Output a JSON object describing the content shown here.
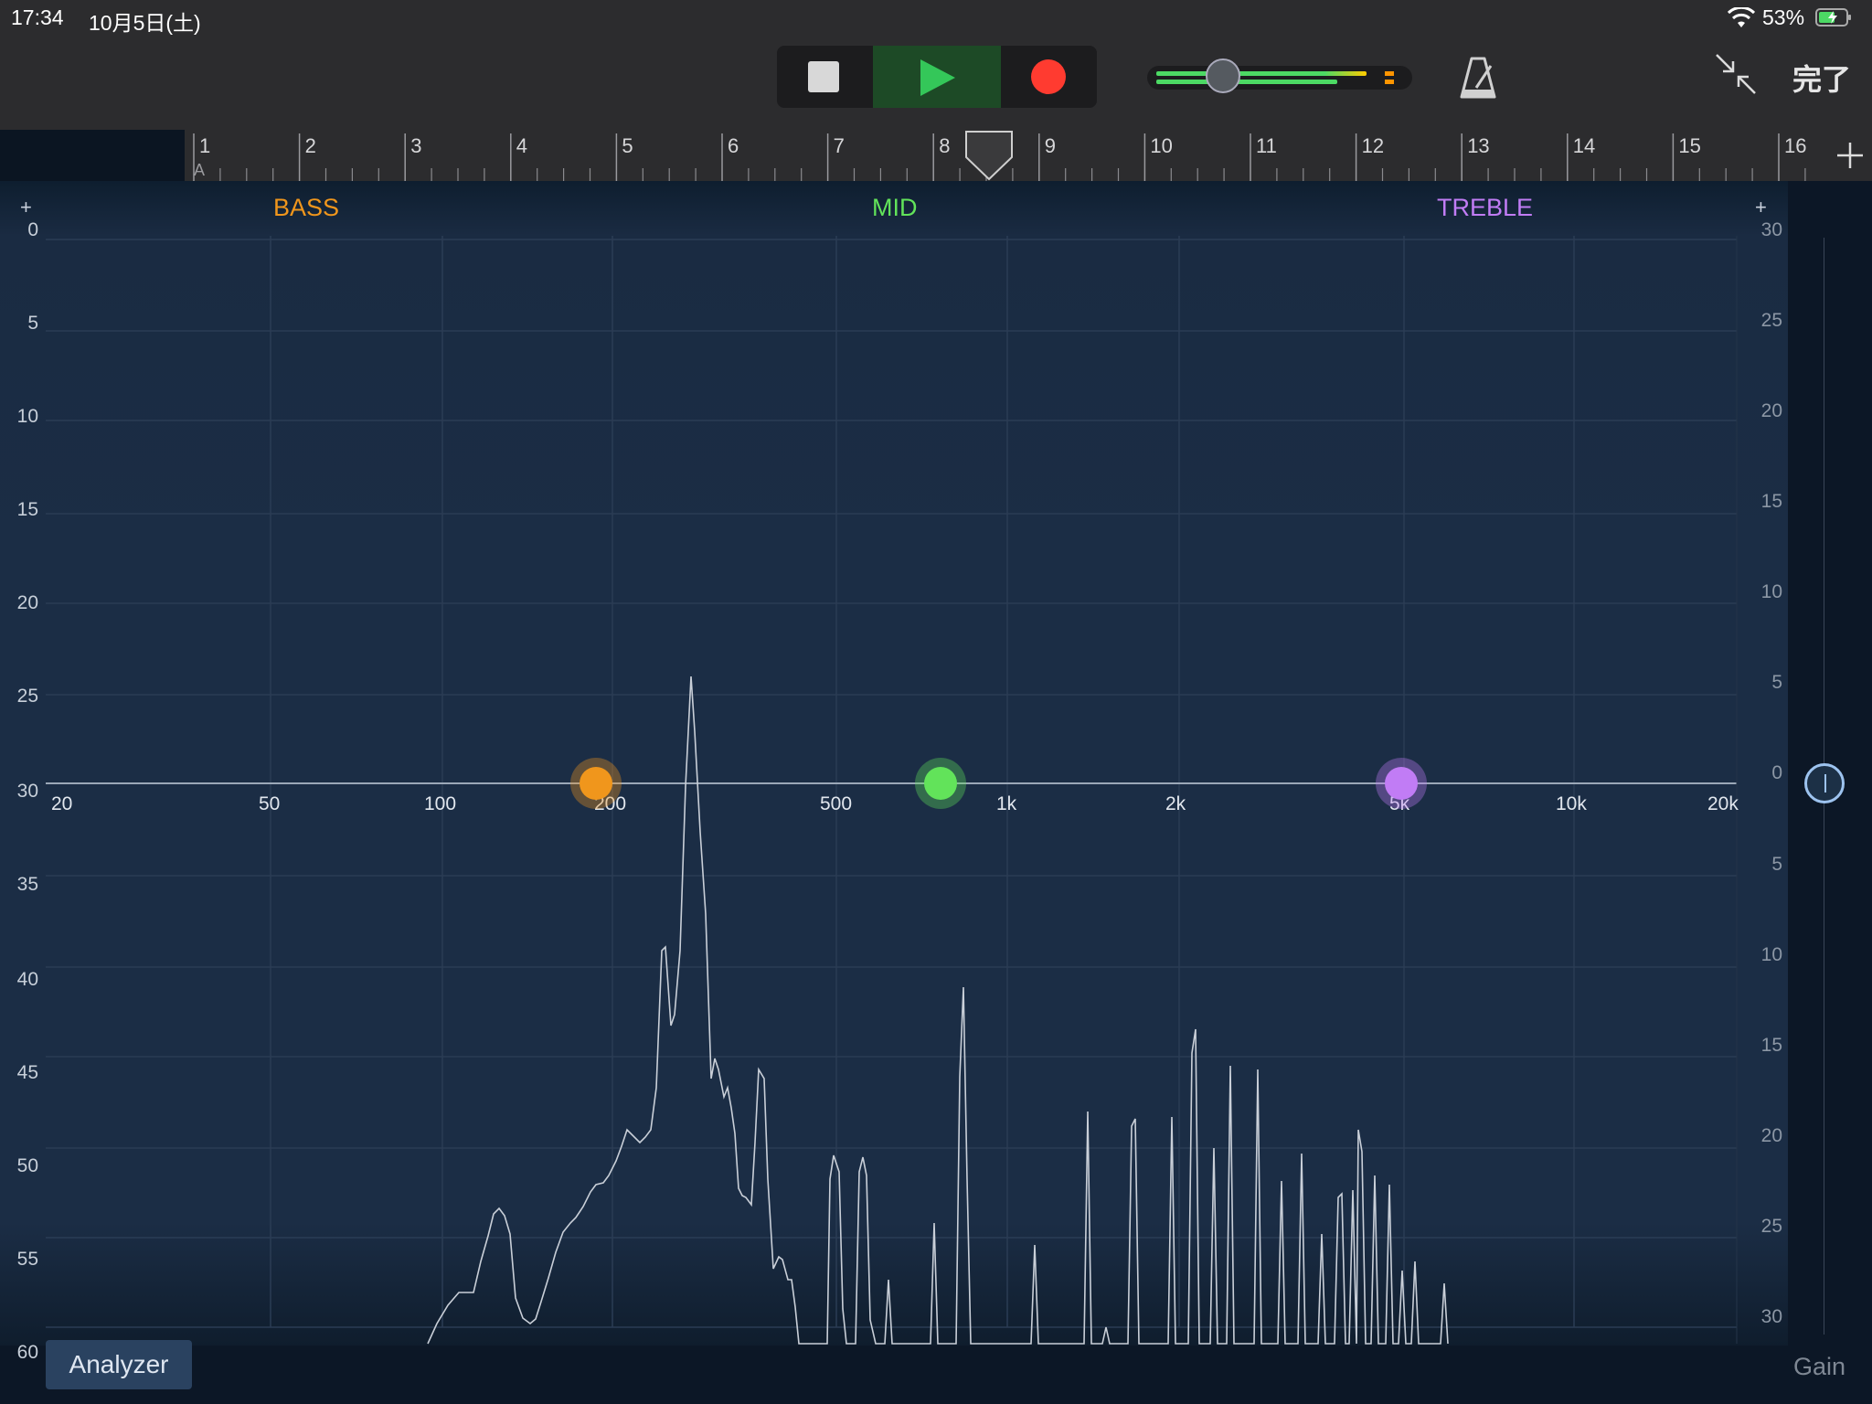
{
  "status_bar": {
    "time": "17:34",
    "date": "10月5日(土)",
    "battery": "53%"
  },
  "toolbar": {
    "done_label": "完了"
  },
  "colors": {
    "bass": "#f0961c",
    "mid": "#62e35a",
    "treble": "#c17cf5",
    "play_bg": "#1d4a26",
    "record": "#ff3b30"
  },
  "ruler": {
    "bars": [
      "1",
      "2",
      "3",
      "4",
      "5",
      "6",
      "7",
      "8",
      "9",
      "10",
      "11",
      "12",
      "13",
      "14",
      "15",
      "16"
    ],
    "section_label": "A"
  },
  "eq": {
    "bands": {
      "bass": "BASS",
      "mid": "MID",
      "treble": "TREBLE"
    },
    "left_axis": [
      "0",
      "5",
      "10",
      "15",
      "20",
      "25",
      "30",
      "35",
      "40",
      "45",
      "50",
      "55",
      "60"
    ],
    "right_axis": [
      "30",
      "25",
      "20",
      "15",
      "10",
      "5",
      "0",
      "5",
      "10",
      "15",
      "20",
      "25",
      "30"
    ],
    "freq_labels": [
      "20",
      "50",
      "100",
      "200",
      "500",
      "1k",
      "2k",
      "5k",
      "10k",
      "20k"
    ],
    "nodes": [
      {
        "name": "bass",
        "gain_db": 0
      },
      {
        "name": "mid",
        "gain_db": 0
      },
      {
        "name": "treble",
        "gain_db": 0
      }
    ]
  },
  "analyzer_label": "Analyzer",
  "gain_label": "Gain",
  "icons": [
    "wifi-icon",
    "battery-icon",
    "stop-icon",
    "play-icon",
    "record-icon",
    "metronome-icon",
    "shrink-icon",
    "plus-icon"
  ]
}
